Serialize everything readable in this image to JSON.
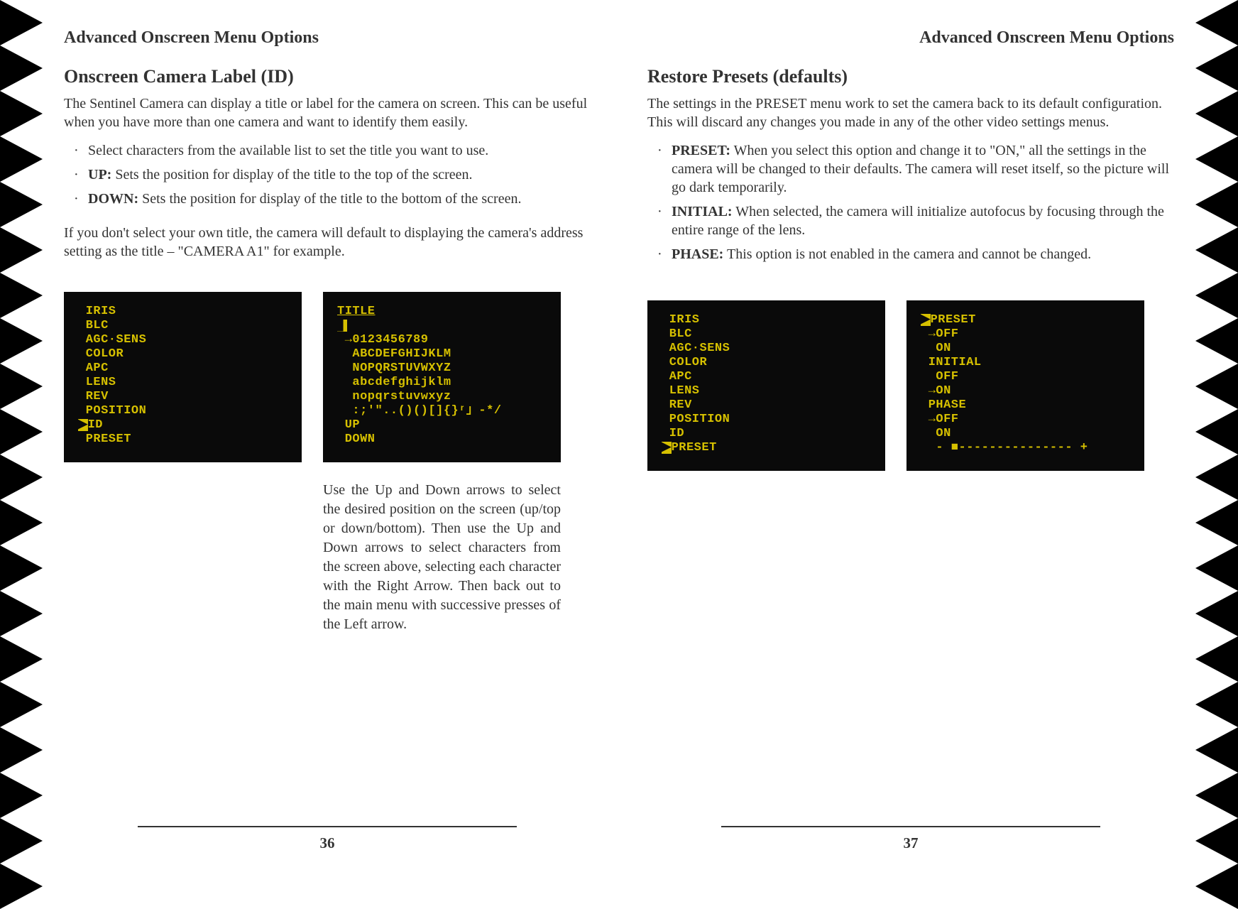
{
  "left": {
    "running_head": "Advanced Onscreen Menu Options",
    "title": "Onscreen Camera Label (ID)",
    "intro": "The Sentinel Camera can display a title or label for the camera on screen. This can be useful when you have more than one camera and want to identify them easily.",
    "bullets": [
      {
        "lead": "",
        "text": "Select characters from the available list to set the title you want to use."
      },
      {
        "lead": "UP:",
        "text": " Sets the position for display of the title to the top of the screen."
      },
      {
        "lead": "DOWN:",
        "text": " Sets the position for display of the title to the bottom of the screen."
      }
    ],
    "outro": "If you don't select your own title, the camera will default to displaying the camera's address setting as the title – \"CAMERA A1\" for example.",
    "osd_left": {
      "lines": [
        " IRIS",
        " BLC",
        " AGC·SENS",
        " COLOR",
        " APC",
        " LENS",
        " REV",
        " POSITION"
      ],
      "cursor_prefix": "▶",
      "cursor_line": "ID",
      "after": [
        " PRESET"
      ]
    },
    "osd_right": {
      "title_line": "TITLE",
      "cursor": "▋",
      "char_rows": [
        " →0123456789",
        "  ABCDEFGHIJKLM",
        "  NOPQRSTUVWXYZ",
        "  abcdefghijklm",
        "  nopqrstuvwxyz",
        "  :;'\"..()()[]{}ʳ」-*/"
      ],
      "footer": [
        " UP",
        " DOWN"
      ]
    },
    "caption": "Use the Up and Down arrows to select the desired position on the screen (up/top or down/bottom). Then use the Up and Down arrows to select characters from the screen above, selecting each character with the Right Arrow.  Then back out to the main menu with successive presses of the Left arrow.",
    "page_num": "36"
  },
  "right": {
    "running_head": "Advanced Onscreen Menu Options",
    "title": "Restore Presets (defaults)",
    "intro": "The settings in the PRESET menu work to set the camera back to its default configuration. This will discard any changes you made in any of the other video settings menus.",
    "bullets": [
      {
        "lead": "PRESET:",
        "text": " When you select this option and change it to \"ON,\" all the settings in the camera will be changed to their defaults. The camera will reset itself, so the picture will go dark temporarily."
      },
      {
        "lead": "INITIAL:",
        "text": " When selected, the camera will initialize autofocus by focusing through the entire range of the lens."
      },
      {
        "lead": "PHASE:",
        "text": " This option is not enabled in the camera and cannot be changed."
      }
    ],
    "osd_left": {
      "lines": [
        " IRIS",
        " BLC",
        " AGC·SENS",
        " COLOR",
        " APC",
        " LENS",
        " REV",
        " POSITION",
        " ID"
      ],
      "cursor_prefix": "▶",
      "cursor_line": "PRESET"
    },
    "osd_right": {
      "lines": [
        "▶PRESET",
        " →OFF",
        "  ON",
        " INITIAL",
        "  OFF",
        " →ON",
        " PHASE",
        " →OFF",
        "  ON"
      ],
      "slider": "  - ■--------------- +"
    },
    "page_num": "37"
  }
}
